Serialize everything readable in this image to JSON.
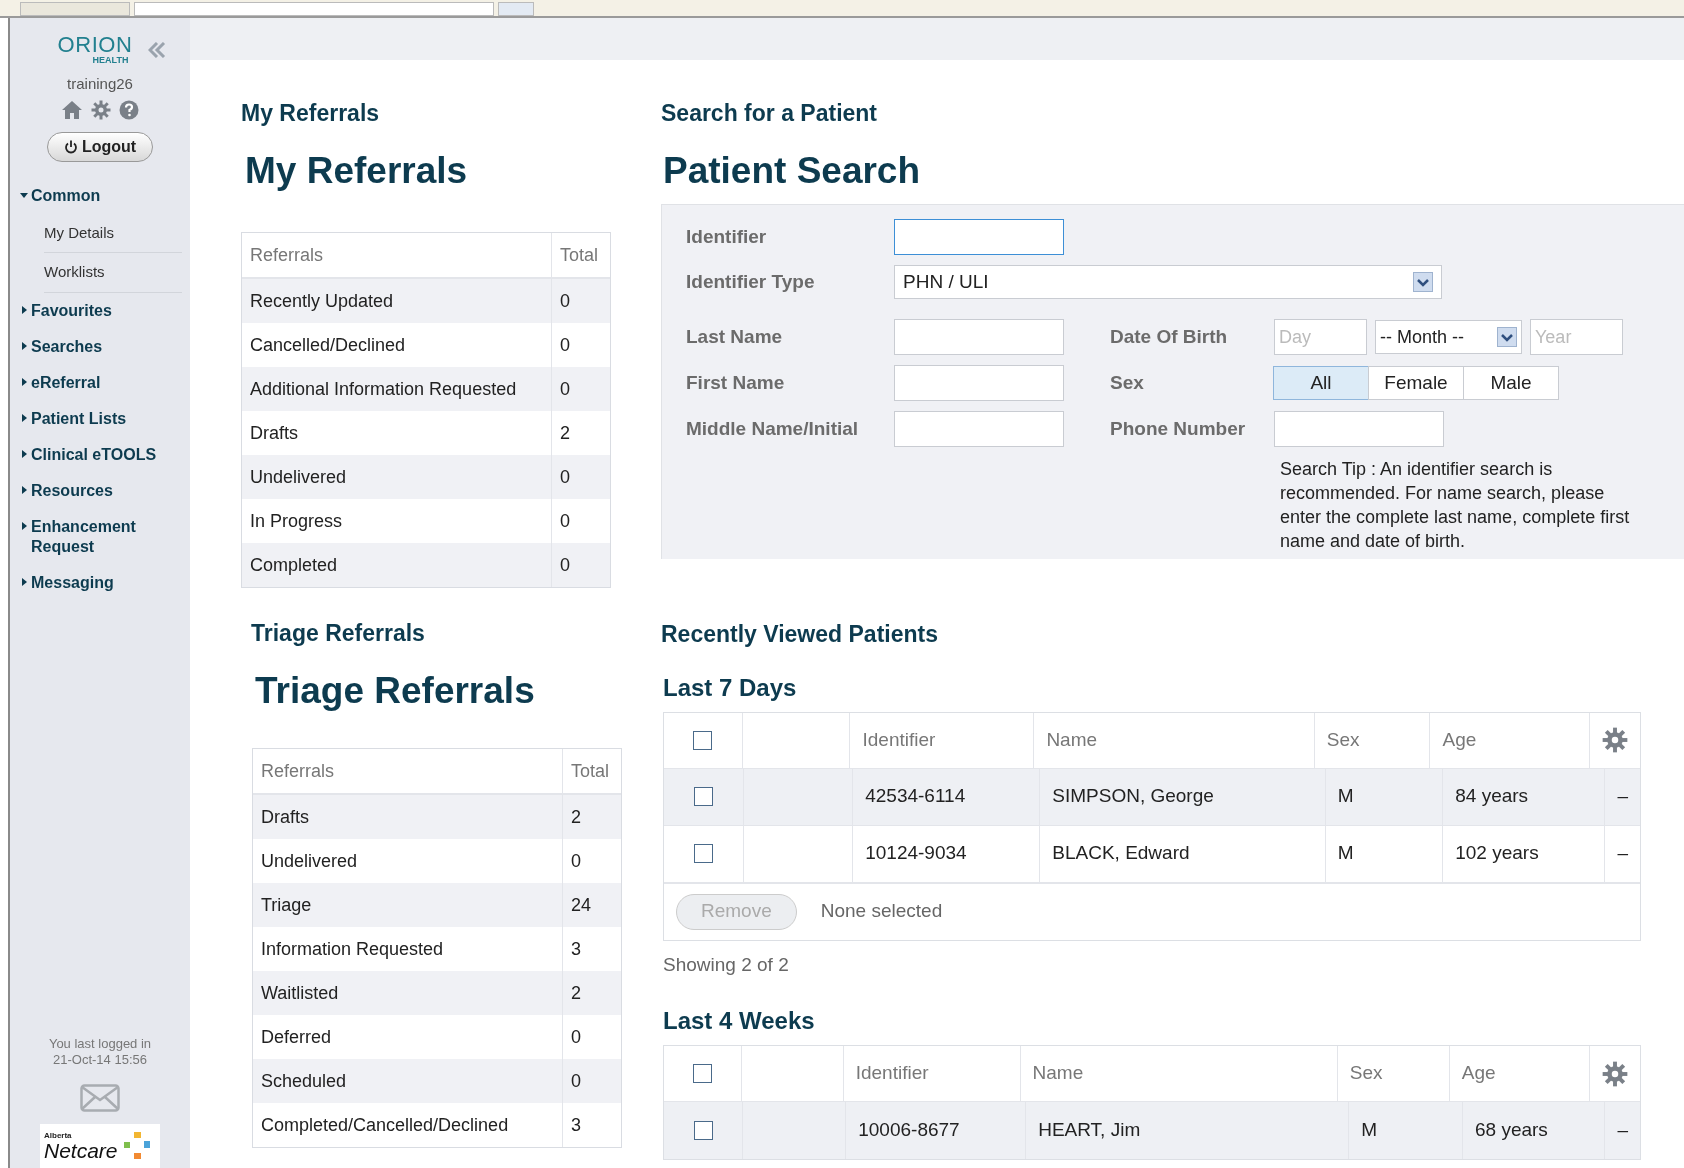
{
  "sidebar": {
    "logo": {
      "name": "ORION",
      "tagline": "HEALTH"
    },
    "username": "training26",
    "logout": "Logout",
    "items": [
      {
        "label": "Common",
        "expanded": true,
        "children": [
          {
            "label": "My Details"
          },
          {
            "label": "Worklists"
          }
        ]
      },
      {
        "label": "Favourites",
        "expanded": false
      },
      {
        "label": "Searches",
        "expanded": false
      },
      {
        "label": "eReferral",
        "expanded": false
      },
      {
        "label": "Patient Lists",
        "expanded": false
      },
      {
        "label": "Clinical eTOOLS",
        "expanded": false
      },
      {
        "label": "Resources",
        "expanded": false
      },
      {
        "label": "Enhancement Request",
        "expanded": false
      },
      {
        "label": "Messaging",
        "expanded": false
      }
    ],
    "last_login": [
      "You last logged in",
      "21-Oct-14 15:56"
    ],
    "footer_logo": {
      "region": "Alberta",
      "name": "Netcare"
    }
  },
  "my_referrals": {
    "section": "My Referrals",
    "title": "My Referrals",
    "columns": [
      "Referrals",
      "Total"
    ],
    "rows": [
      [
        "Recently Updated",
        "0"
      ],
      [
        "Cancelled/Declined",
        "0"
      ],
      [
        "Additional Information Requested",
        "0"
      ],
      [
        "Drafts",
        "2"
      ],
      [
        "Undelivered",
        "0"
      ],
      [
        "In Progress",
        "0"
      ],
      [
        "Completed",
        "0"
      ]
    ]
  },
  "triage_referrals": {
    "section": "Triage Referrals",
    "title": "Triage Referrals",
    "columns": [
      "Referrals",
      "Total"
    ],
    "rows": [
      [
        "Drafts",
        "2"
      ],
      [
        "Undelivered",
        "0"
      ],
      [
        "Triage",
        "24"
      ],
      [
        "Information Requested",
        "3"
      ],
      [
        "Waitlisted",
        "2"
      ],
      [
        "Deferred",
        "0"
      ],
      [
        "Scheduled",
        "0"
      ],
      [
        "Completed/Cancelled/Declined",
        "3"
      ]
    ]
  },
  "patient_search": {
    "section": "Search for a Patient",
    "title": "Patient Search",
    "identifier": {
      "label": "Identifier",
      "focused": true
    },
    "identifier_type": {
      "label": "Identifier Type",
      "value": "PHN / ULI"
    },
    "last_name": {
      "label": "Last Name"
    },
    "first_name": {
      "label": "First Name"
    },
    "middle_name": {
      "label": "Middle Name/Initial"
    },
    "date_of_birth": {
      "label": "Date Of Birth",
      "day_placeholder": "Day",
      "month": "-- Month --",
      "year_placeholder": "Year"
    },
    "sex": {
      "label": "Sex",
      "options": [
        {
          "label": "All",
          "selected": true
        },
        {
          "label": "Female",
          "selected": false
        },
        {
          "label": "Male",
          "selected": false
        }
      ]
    },
    "phone": {
      "label": "Phone Number"
    },
    "tip": "Search Tip : An identifier search is recommended. For name search, please enter the complete last name, complete first name and date of birth."
  },
  "recently_viewed": {
    "title": "Recently Viewed Patients",
    "groups": [
      {
        "title": "Last 7 Days",
        "columns": [
          "Identifier",
          "Name",
          "Sex",
          "Age"
        ],
        "all_checked": false,
        "rows": [
          {
            "checked": false,
            "cells": [
              "42534-6114",
              "SIMPSON, George",
              "M",
              "84 years",
              "–"
            ]
          },
          {
            "checked": false,
            "cells": [
              "10124-9034",
              "BLACK, Edward",
              "M",
              "102 years",
              "–"
            ]
          }
        ],
        "footer": {
          "button": "Remove",
          "disabled": true,
          "status": "None selected"
        },
        "showing": "Showing 2 of 2"
      },
      {
        "title": "Last 4 Weeks",
        "columns": [
          "Identifier",
          "Name",
          "Sex",
          "Age"
        ],
        "all_checked": false,
        "rows": [
          {
            "checked": false,
            "cells": [
              "10006-8677",
              "HEART, Jim",
              "M",
              "68 years",
              "–"
            ]
          }
        ]
      }
    ]
  }
}
